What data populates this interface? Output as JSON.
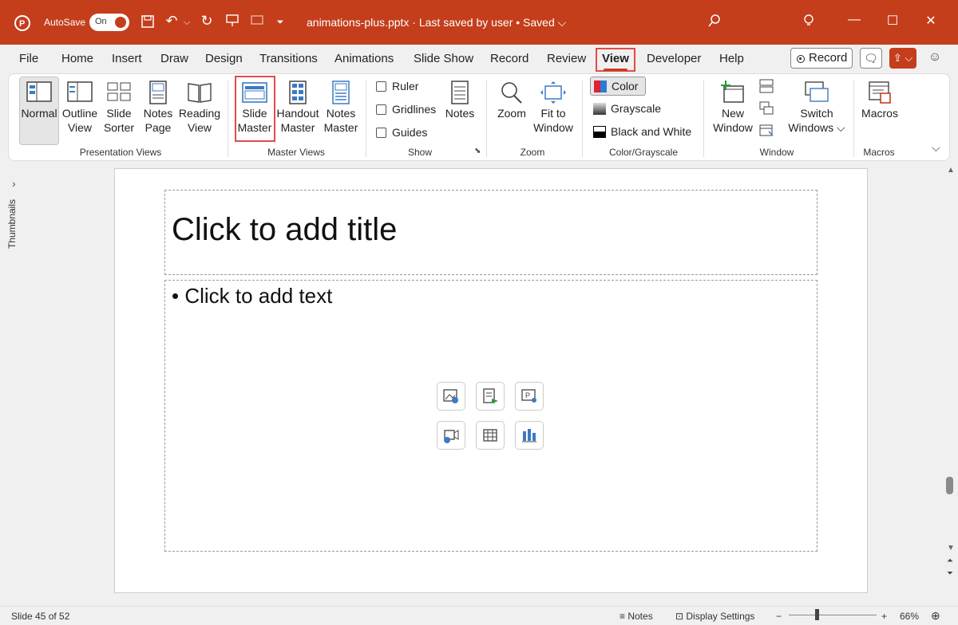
{
  "titlebar": {
    "autosave_label": "AutoSave",
    "toggle_state": "On",
    "doc_title": "animations-plus.pptx  ·  Last saved by user  •  Saved ⌵",
    "colors": {
      "brand": "#c43e1c",
      "highlight": "#e34a4a"
    }
  },
  "menu": {
    "items": [
      "File",
      "Home",
      "Insert",
      "Draw",
      "Design",
      "Transitions",
      "Animations",
      "Slide Show",
      "Record",
      "Review",
      "View",
      "Developer",
      "Help"
    ],
    "active": "View",
    "record_label": "Record"
  },
  "ribbon": {
    "presentation_views": {
      "label": "Presentation Views",
      "buttons": [
        {
          "line1": "Normal",
          "line2": ""
        },
        {
          "line1": "Outline",
          "line2": "View"
        },
        {
          "line1": "Slide",
          "line2": "Sorter"
        },
        {
          "line1": "Notes",
          "line2": "Page"
        },
        {
          "line1": "Reading",
          "line2": "View"
        }
      ]
    },
    "master_views": {
      "label": "Master Views",
      "buttons": [
        {
          "line1": "Slide",
          "line2": "Master"
        },
        {
          "line1": "Handout",
          "line2": "Master"
        },
        {
          "line1": "Notes",
          "line2": "Master"
        }
      ]
    },
    "show": {
      "label": "Show",
      "checkboxes": [
        "Ruler",
        "Gridlines",
        "Guides"
      ],
      "notes_label": "Notes"
    },
    "zoom": {
      "label": "Zoom",
      "zoom_btn": "Zoom",
      "fit_line1": "Fit to",
      "fit_line2": "Window"
    },
    "color_grayscale": {
      "label": "Color/Grayscale",
      "items": [
        "Color",
        "Grayscale",
        "Black and White"
      ]
    },
    "window": {
      "label": "Window",
      "new_line1": "New",
      "new_line2": "Window",
      "switch_line1": "Switch",
      "switch_line2": "Windows ⌵"
    },
    "macros": {
      "label": "Macros",
      "btn": "Macros"
    }
  },
  "side": {
    "thumbnails_label": "Thumbnails"
  },
  "slide": {
    "title_placeholder": "Click to add title",
    "body_placeholder": "• Click to add text"
  },
  "status": {
    "slide_info": "Slide 45 of 52",
    "notes": "Notes",
    "display_settings": "Display Settings",
    "zoom_level": "66%"
  }
}
